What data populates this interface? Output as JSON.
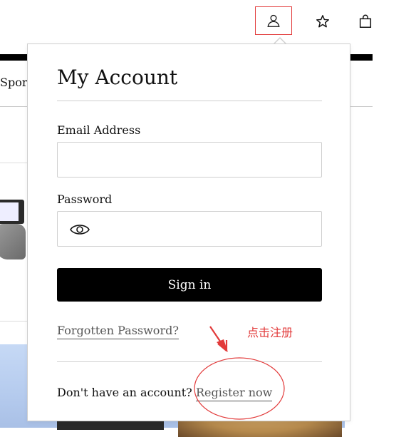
{
  "header": {
    "icons": [
      "user-icon",
      "star-icon",
      "shopping-bag-icon"
    ]
  },
  "background": {
    "nav_partial_text": "Sport"
  },
  "account_dropdown": {
    "title": "My Account",
    "email_label": "Email Address",
    "email_value": "",
    "password_label": "Password",
    "password_value": "",
    "show_password_icon": "eye-icon",
    "sign_in_label": "Sign in",
    "forgot_password_label": "Forgotten Password?",
    "no_account_text": "Don't have an account?",
    "register_label": "Register now"
  },
  "annotation": {
    "text": "点击注册",
    "color": "#e23a3a"
  },
  "colors": {
    "primary_button": "#000000",
    "border": "#cfcfcf",
    "link": "#555555"
  }
}
